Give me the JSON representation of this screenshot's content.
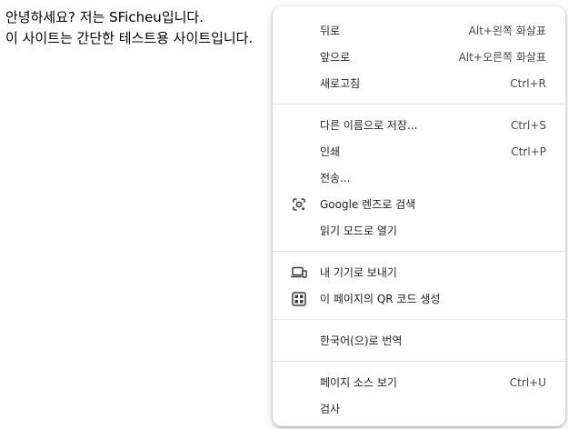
{
  "page": {
    "line1": "안녕하세요? 저는 SFicheu입니다.",
    "line2": "이 사이트는 간단한 테스트용 사이트입니다."
  },
  "menu": {
    "groups": [
      [
        {
          "label": "뒤로",
          "shortcut": "Alt+왼쪽 화살표"
        },
        {
          "label": "앞으로",
          "shortcut": "Alt+오른쪽 화살표"
        },
        {
          "label": "새로고침",
          "shortcut": "Ctrl+R"
        }
      ],
      [
        {
          "label": "다른 이름으로 저장...",
          "shortcut": "Ctrl+S"
        },
        {
          "label": "인쇄",
          "shortcut": "Ctrl+P"
        },
        {
          "label": "전송...",
          "shortcut": ""
        },
        {
          "label": "Google 렌즈로 검색",
          "shortcut": "",
          "icon": "google-lens-icon"
        },
        {
          "label": "읽기 모드로 열기",
          "shortcut": ""
        }
      ],
      [
        {
          "label": "내 기기로 보내기",
          "shortcut": "",
          "icon": "send-to-devices-icon"
        },
        {
          "label": "이 페이지의 QR 코드 생성",
          "shortcut": "",
          "icon": "qr-code-icon"
        }
      ],
      [
        {
          "label": "한국어(으)로 번역",
          "shortcut": ""
        }
      ],
      [
        {
          "label": "페이지 소스 보기",
          "shortcut": "Ctrl+U"
        },
        {
          "label": "검사",
          "shortcut": ""
        }
      ]
    ]
  }
}
